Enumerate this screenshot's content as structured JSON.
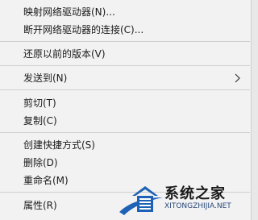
{
  "context_menu": {
    "items": [
      {
        "label": "映射网络驱动器(N)..."
      },
      {
        "label": "断开网络驱动器的连接(C)..."
      },
      {
        "label": "还原以前的版本(V)"
      },
      {
        "label": "发送到(N)"
      },
      {
        "label": "剪切(T)"
      },
      {
        "label": "复制(C)"
      },
      {
        "label": "创建快捷方式(S)"
      },
      {
        "label": "删除(D)"
      },
      {
        "label": "重命名(M)"
      },
      {
        "label": "属性(R)"
      }
    ]
  },
  "watermark": {
    "brand": "系统之家",
    "url": "XITONGZHIJIA.NET",
    "icon": "house-logo-icon",
    "accent_color": "#1e62b5"
  },
  "icons": {
    "submenu": "chevron-right-icon"
  }
}
